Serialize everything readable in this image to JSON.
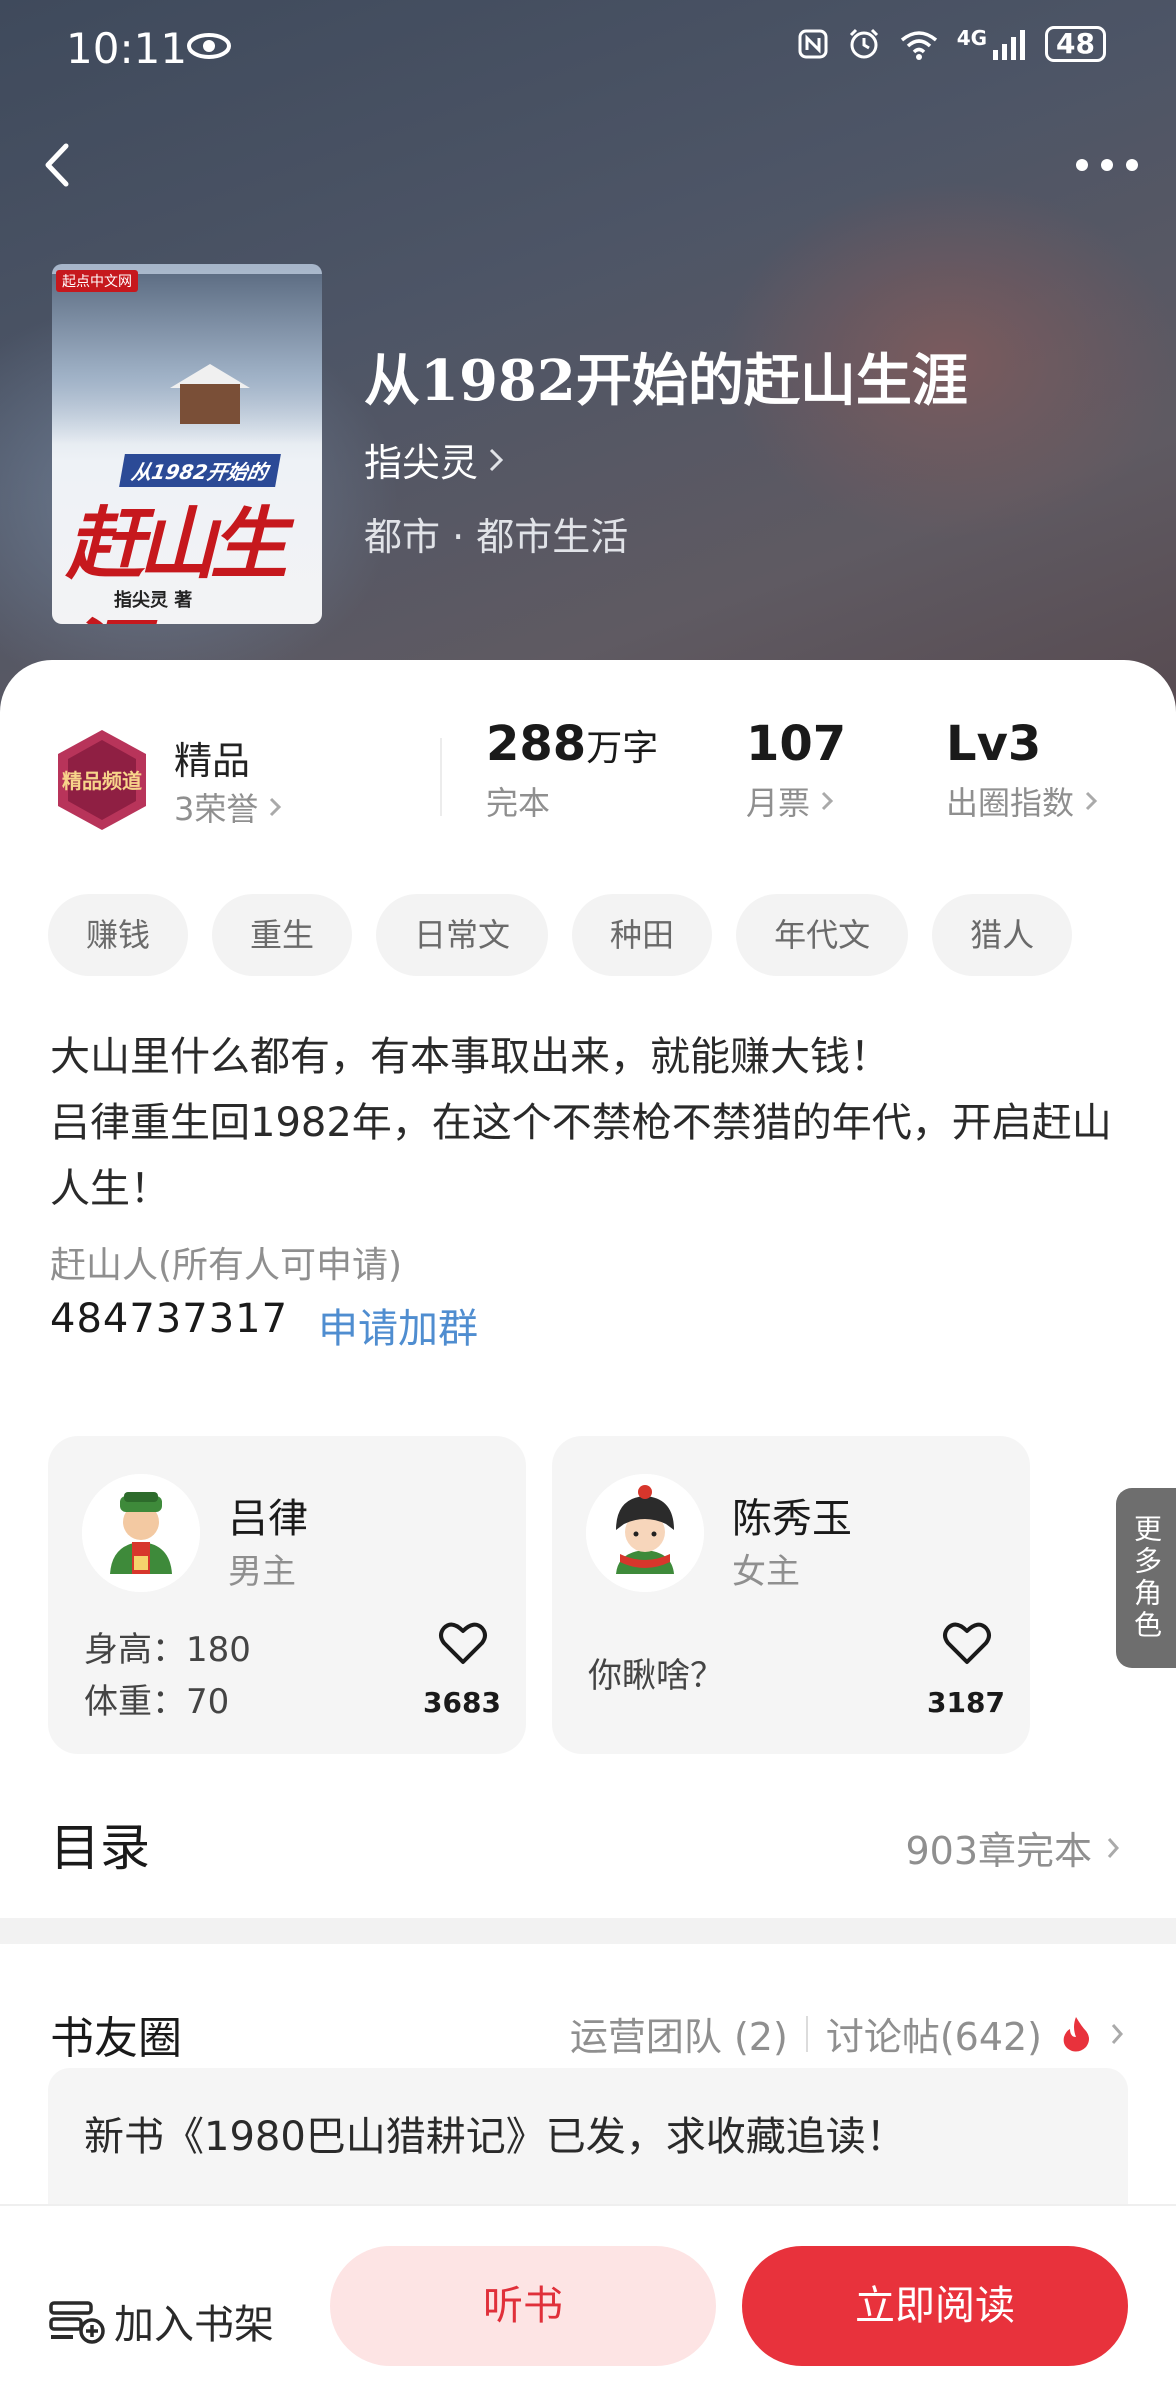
{
  "status_bar": {
    "time": "10:11",
    "network": "4G",
    "battery": "48"
  },
  "book": {
    "title": "从1982开始的赶山生涯",
    "author": "指尖灵",
    "genre": "都市 · 都市生活",
    "cover": {
      "subtitle": "从1982开始的",
      "big_title": "赶山生涯",
      "author": "指尖灵 著",
      "publisher": "起点中文网"
    }
  },
  "stats": {
    "badge": {
      "emblem": "精品频道",
      "title": "精品",
      "subtitle": "3荣誉"
    },
    "words": {
      "number": "288",
      "unit": "万字",
      "label": "完本"
    },
    "monthly": {
      "number": "107",
      "label": "月票"
    },
    "index": {
      "number": "Lv3",
      "label": "出圈指数"
    }
  },
  "tags": [
    "赚钱",
    "重生",
    "日常文",
    "种田",
    "年代文",
    "猎人"
  ],
  "description": {
    "line1": "大山里什么都有，有本事取出来，就能赚大钱！",
    "line2": "吕律重生回1982年，在这个不禁枪不禁猎的年代，开启赶山人生！"
  },
  "group": {
    "name": "赶山人(所有人可申请)",
    "number": "484737317",
    "join": "申请加群"
  },
  "roles": [
    {
      "name": "吕律",
      "type": "男主",
      "info1": "身高：180",
      "info2": "体重：70",
      "likes": "3683"
    },
    {
      "name": "陈秀玉",
      "type": "女主",
      "info1": "你瞅啥？",
      "likes": "3187"
    }
  ],
  "more_roles": "更多角色",
  "toc": {
    "title": "目录",
    "count": "903章完本"
  },
  "circle": {
    "title": "书友圈",
    "team": "运营团队 (2)",
    "posts": "讨论帖(642)",
    "latest": "新书《1980巴山猎耕记》已发，求收藏追读！"
  },
  "bottom": {
    "shelf": "加入书架",
    "listen": "听书",
    "read": "立即阅读"
  },
  "colors": {
    "accent": "#e8323c",
    "accent_light": "#fde4e4",
    "link": "#4f8dd0"
  }
}
